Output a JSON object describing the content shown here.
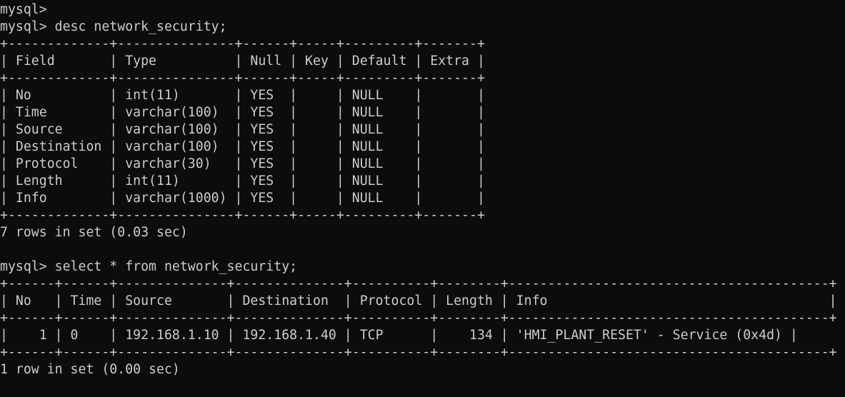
{
  "terminal": {
    "lines": [
      "mysql>",
      "mysql> desc network_security;",
      "+-------------+---------------+------+-----+---------+-------+",
      "| Field       | Type          | Null | Key | Default | Extra |",
      "+-------------+---------------+------+-----+---------+-------+",
      "| No          | int(11)       | YES  |     | NULL    |       |",
      "| Time        | varchar(100)  | YES  |     | NULL    |       |",
      "| Source      | varchar(100)  | YES  |     | NULL    |       |",
      "| Destination | varchar(100)  | YES  |     | NULL    |       |",
      "| Protocol    | varchar(30)   | YES  |     | NULL    |       |",
      "| Length      | int(11)       | YES  |     | NULL    |       |",
      "| Info        | varchar(1000) | YES  |     | NULL    |       |",
      "+-------------+---------------+------+-----+---------+-------+",
      "7 rows in set (0.03 sec)",
      "",
      "mysql> select * from network_security;",
      "+------+------+--------------+--------------+----------+--------+-----------------------------------------+",
      "| No   | Time | Source       | Destination  | Protocol | Length | Info                                    |",
      "+------+------+--------------+--------------+----------+--------+-----------------------------------------+",
      "|    1 | 0    | 192.168.1.10 | 192.168.1.40 | TCP      |    134 | 'HMI_PLANT_RESET' - Service (0x4d) |",
      "+------+------+--------------+--------------+----------+--------+-----------------------------------------+",
      "1 row in set (0.00 sec)"
    ]
  }
}
